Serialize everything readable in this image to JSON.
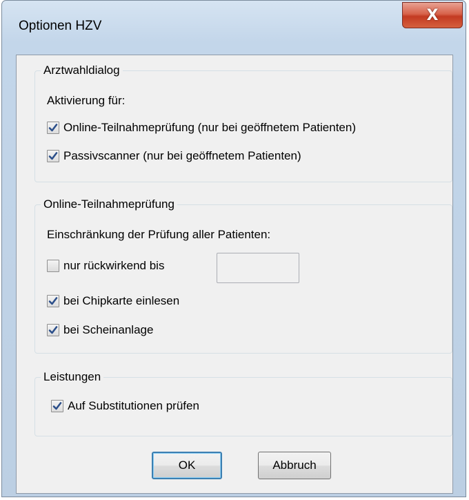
{
  "window": {
    "title": "Optionen HZV",
    "close_glyph": "X"
  },
  "arztwahl": {
    "legend": "Arztwahldialog",
    "subtitle": "Aktivierung für:",
    "options": [
      {
        "label": "Online-Teilnahmeprüfung (nur bei geöffnetem Patienten)",
        "checked": true
      },
      {
        "label": "Passivscanner (nur bei geöffnetem Patienten)",
        "checked": true
      }
    ]
  },
  "online": {
    "legend": "Online-Teilnahmeprüfung",
    "subtitle": "Einschränkung der Prüfung aller Patienten:",
    "options": [
      {
        "label": "nur rückwirkend bis",
        "checked": false
      },
      {
        "label": "bei Chipkarte einlesen",
        "checked": true
      },
      {
        "label": "bei Scheinanlage",
        "checked": true
      }
    ],
    "days_value": ""
  },
  "leistungen": {
    "legend": "Leistungen",
    "options": [
      {
        "label": "Auf Substitutionen prüfen",
        "checked": true
      }
    ]
  },
  "buttons": {
    "ok": "OK",
    "cancel": "Abbruch"
  },
  "colors": {
    "check_mark": "#2c4f8a",
    "close_button": "#c33a22"
  }
}
